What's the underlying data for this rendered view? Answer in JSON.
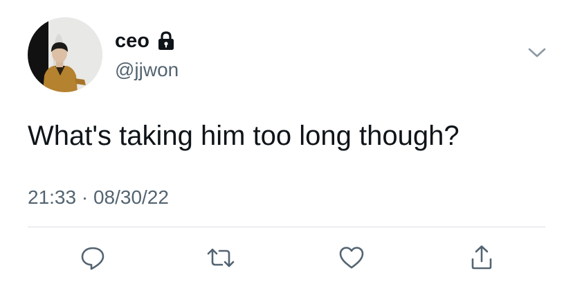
{
  "tweet": {
    "display_name": "ceo",
    "handle": "@jjwon",
    "text": "What's taking him too long though?",
    "timestamp": "21:33 · 08/30/22",
    "protected": true
  },
  "icons": {
    "lock": "lock-icon",
    "caret": "chevron-down-icon",
    "reply": "reply-icon",
    "retweet": "retweet-icon",
    "like": "heart-icon",
    "share": "share-icon"
  },
  "colors": {
    "text_primary": "#0f1419",
    "text_secondary": "#536471",
    "icon_gray": "#536471",
    "divider": "#d9dde1",
    "background": "#ffffff"
  }
}
